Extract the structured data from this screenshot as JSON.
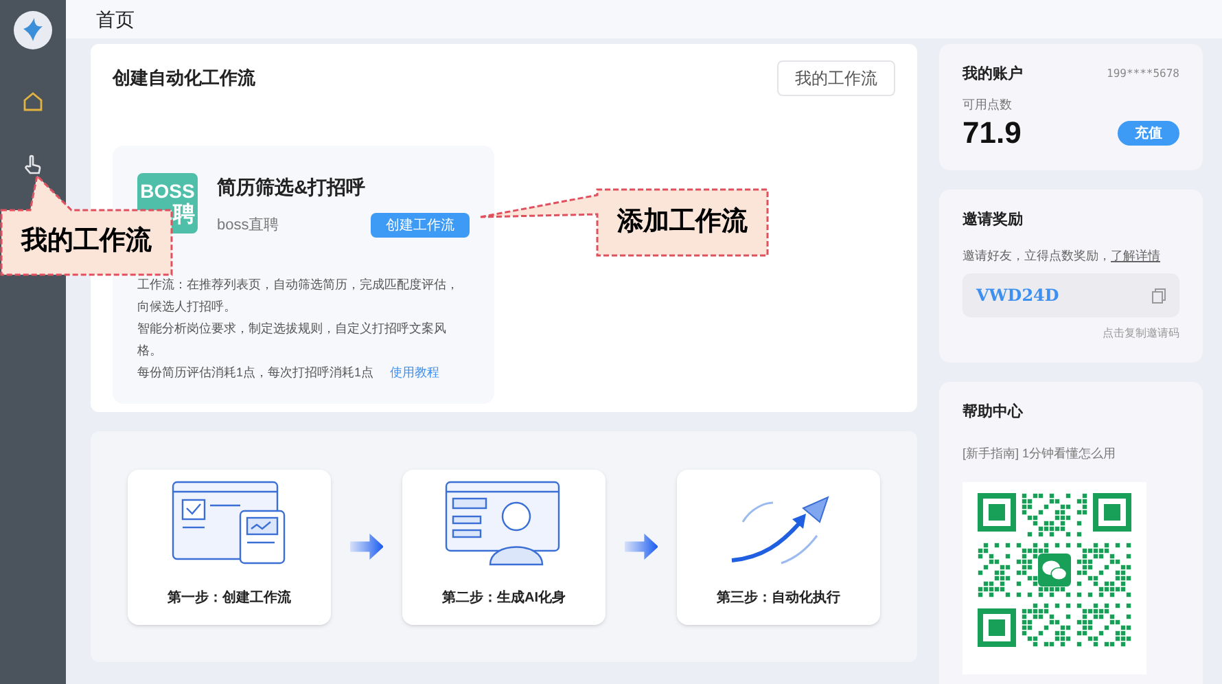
{
  "sidebar": {
    "items": [
      {
        "kind": "home",
        "selected": true
      },
      {
        "kind": "pointer",
        "selected": false
      }
    ]
  },
  "header": {
    "title": "首页"
  },
  "workflow_panel": {
    "title": "创建自动化工作流",
    "my_workflows_button": "我的工作流",
    "card": {
      "logo_lines": [
        "BOSS",
        "聘"
      ],
      "title": "简历筛选&打招呼",
      "source": "boss直聘",
      "create_button": "创建工作流",
      "description": [
        "工作流：在推荐列表页，自动筛选简历，完成匹配度评估，向候选人打招呼。",
        "智能分析岗位要求，制定选拔规则，自定义打招呼文案风格。"
      ],
      "cost": "每份简历评估消耗1点，每次打招呼消耗1点",
      "tutorial_link": "使用教程"
    }
  },
  "steps": [
    {
      "kind": "create",
      "label": "第一步：创建工作流"
    },
    {
      "kind": "avatar",
      "label": "第二步：生成AI化身"
    },
    {
      "kind": "run",
      "label": "第三步：自动化执行"
    }
  ],
  "account": {
    "title": "我的账户",
    "phone": "199****5678",
    "points_label": "可用点数",
    "points": "71.9",
    "recharge_button": "充值"
  },
  "invite": {
    "title": "邀请奖励",
    "text": "邀请好友，立得点数奖励，",
    "details_link": "了解详情",
    "code": "VWD24D",
    "hint": "点击复制邀请码"
  },
  "help": {
    "title": "帮助中心",
    "guide": "[新手指南] 1分钟看懂怎么用"
  },
  "callouts": [
    {
      "kind": "sidebar",
      "text": "我的工作流"
    },
    {
      "kind": "button",
      "text": "添加工作流"
    }
  ]
}
